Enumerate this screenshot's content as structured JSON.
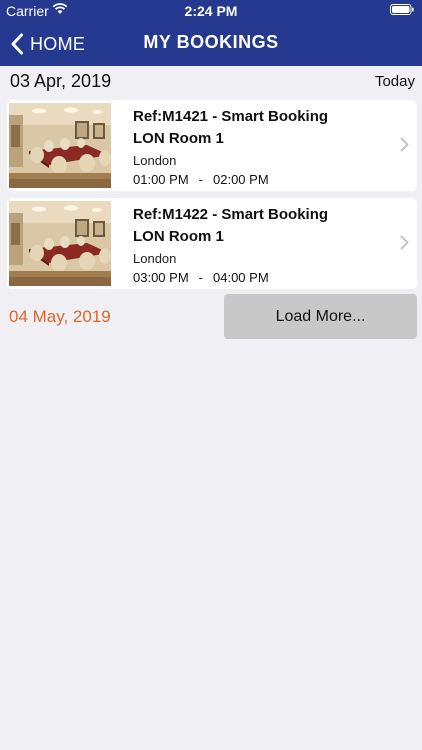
{
  "status_bar": {
    "carrier": "Carrier",
    "time": "2:24 PM"
  },
  "nav": {
    "back_label": "HOME",
    "title": "MY BOOKINGS"
  },
  "sections": [
    {
      "date": "03 Apr, 2019",
      "tag": "Today",
      "bookings": [
        {
          "ref": "Ref:M1421 - Smart Booking",
          "room": "LON Room 1",
          "city": "London",
          "start": "01:00 PM",
          "separator": "-",
          "end": "02:00 PM"
        },
        {
          "ref": "Ref:M1422 - Smart Booking",
          "room": "LON Room 1",
          "city": "London",
          "start": "03:00 PM",
          "separator": "-",
          "end": "04:00 PM"
        }
      ]
    }
  ],
  "next": {
    "date": "04 May, 2019",
    "load_more_label": "Load More..."
  },
  "colors": {
    "nav_background": "#24398f",
    "next_date": "#e0652b",
    "load_more_background": "#c8c8c8",
    "page_background": "#efeff4"
  },
  "icons": {
    "back": "chevron-left-icon",
    "row_disclosure": "chevron-right-icon",
    "wifi": "wifi-icon",
    "battery": "battery-icon",
    "thumbnail": "meeting-room-photo"
  }
}
